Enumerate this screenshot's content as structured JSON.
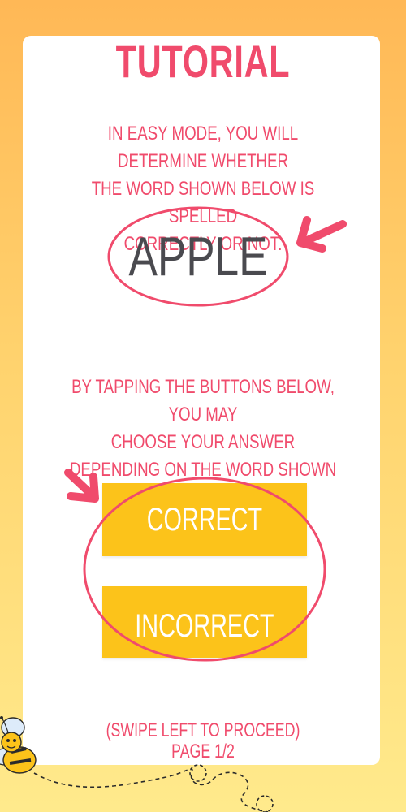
{
  "tutorial": {
    "title": "TUTORIAL",
    "instruction_top": "IN EASY MODE, YOU WILL DETERMINE WHETHER THE WORD SHOWN BELOW IS SPELLED CORRECTLY OR NOT.",
    "sample_word": "APPLE",
    "instruction_bottom_line1": "BY TAPPING THE BUTTONS BELOW, YOU MAY",
    "instruction_bottom_line2": "CHOOSE YOUR ANSWER",
    "instruction_bottom_line3": "DEPENDING ON THE WORD SHOWN ABOVE",
    "instruction_top_line1": "IN EASY MODE, YOU WILL DETERMINE WHETHER",
    "instruction_top_line2": "THE WORD SHOWN BELOW IS SPELLED",
    "instruction_top_line3": "CORRECTLY OR NOT."
  },
  "buttons": {
    "correct_label": "CORRECT",
    "incorrect_label": "INCORRECT"
  },
  "footer": {
    "swipe_hint": "(SWIPE LEFT TO PROCEED)",
    "page_indicator": "PAGE 1/2"
  },
  "colors": {
    "accent": "#F04B6C",
    "button": "#FCC31A",
    "word": "#4A4A4F",
    "background_top": "#FFB856",
    "background_bottom": "#FFEA8C"
  },
  "icons": {
    "word_pointer": "arrow-left-icon",
    "button_pointer": "arrow-down-right-icon",
    "mascot": "bee-icon"
  }
}
